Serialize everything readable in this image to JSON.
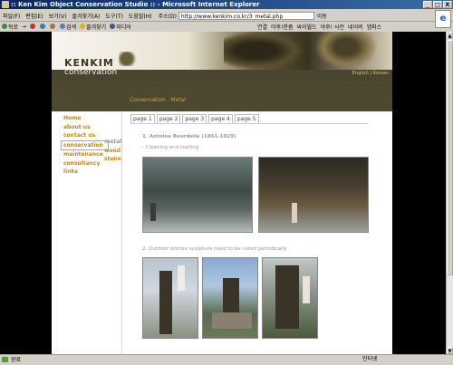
{
  "window": {
    "title": ":: Ken Kim Object Conservation Studio :: - Microsoft Internet Explorer",
    "buttons": [
      "_",
      "□",
      "X"
    ]
  },
  "menubar": {
    "items": [
      "파일(F)",
      "편집(E)",
      "보기(V)",
      "즐겨찾기(A)",
      "도구(T)",
      "도움말(H)"
    ],
    "address_label": "주소(D)",
    "address_value": "http://www.kenkim.co.kr/3_metal.php",
    "go_label": "이동"
  },
  "toolbar": {
    "back": "뒤로",
    "forward": "→",
    "search": "검색",
    "favorites": "즐겨찾기",
    "media": "미디어",
    "links": [
      "연결",
      "야후!한줌",
      "싸이월드",
      "야후! 사전",
      "네이버",
      "엠파스"
    ]
  },
  "site": {
    "logo_line1": "KENKIM",
    "logo_line2": "conservation",
    "lang": "English | Korean",
    "section_title": "Conservation . Metal",
    "nav": [
      "Home",
      "about us",
      "contact us",
      "conservation",
      "maintenance",
      "consultancy",
      "links"
    ],
    "nav_active": "conservation",
    "subnav": [
      "metal",
      "wood",
      "stone"
    ],
    "subnav_active": "metal",
    "tabs": [
      "page 1",
      "page 2",
      "page 3",
      "page 4",
      "page 5"
    ],
    "caption1": "1. Antoine Bourdelle (1861-1929)",
    "caption1b": "- Cleaning and coating",
    "caption2": "2. Outdoor bronze sculpture need to be cared periodically"
  },
  "statusbar": {
    "status": "완료",
    "zone": "인터넷"
  },
  "colors": {
    "accent": "#c08a10",
    "band": "#4d4830"
  }
}
